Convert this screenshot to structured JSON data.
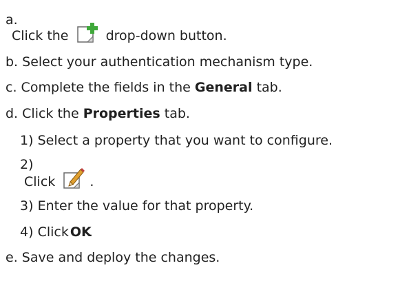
{
  "steps": {
    "a": {
      "marker": "a.",
      "text_before": "Click the",
      "icon": "add-document-icon",
      "text_after": "drop-down button."
    },
    "b": {
      "marker": "b.",
      "text": "Select your authentication mechanism type."
    },
    "c": {
      "marker": "c.",
      "text_before": "Complete the fields in the",
      "bold": "General",
      "text_after": "tab."
    },
    "d": {
      "marker": "d.",
      "text_before": "Click the",
      "bold": "Properties",
      "text_after": "tab.",
      "substeps": [
        {
          "marker": "1)",
          "text": "Select a property that you want to configure."
        },
        {
          "marker": "2)",
          "text_before": "Click",
          "icon": "edit-document-icon",
          "text_after": "."
        },
        {
          "marker": "3)",
          "text": "Enter the value for that property."
        },
        {
          "marker": "4)",
          "text_before": "Click",
          "bold": "OK",
          "text_after": "."
        }
      ]
    },
    "e": {
      "marker": "e.",
      "text": "Save and deploy the changes."
    }
  },
  "colors": {
    "text": "#1f1f1f",
    "icon_plus": "#3fa83a",
    "icon_pencil": "#e0a030"
  }
}
